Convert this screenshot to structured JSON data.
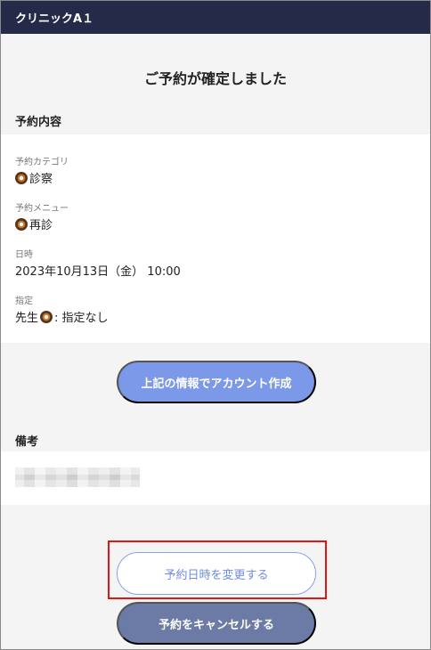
{
  "header": {
    "clinic_name": "クリニックA１"
  },
  "confirmation": {
    "title": "ご予約が確定しました"
  },
  "reservation": {
    "section_label": "予約内容",
    "category_label": "予約カテゴリ",
    "category_value": "診察",
    "menu_label": "予約メニュー",
    "menu_value": "再診",
    "datetime_label": "日時",
    "datetime_value": "2023年10月13日（金） 10:00",
    "doctor_label": "指定",
    "doctor_prefix": "先生",
    "doctor_value": ": 指定なし"
  },
  "actions": {
    "create_account_label": "上記の情報でアカウント作成",
    "change_datetime_label": "予約日時を変更する",
    "cancel_label": "予約をキャンセルする"
  },
  "notes": {
    "section_label": "備考"
  },
  "colors": {
    "header_bg": "#252a48",
    "primary_button": "#7b98e9",
    "cancel_button": "#6c7aa6",
    "highlight": "#e01616"
  },
  "icons": {
    "item_icon": "donut-icon"
  }
}
